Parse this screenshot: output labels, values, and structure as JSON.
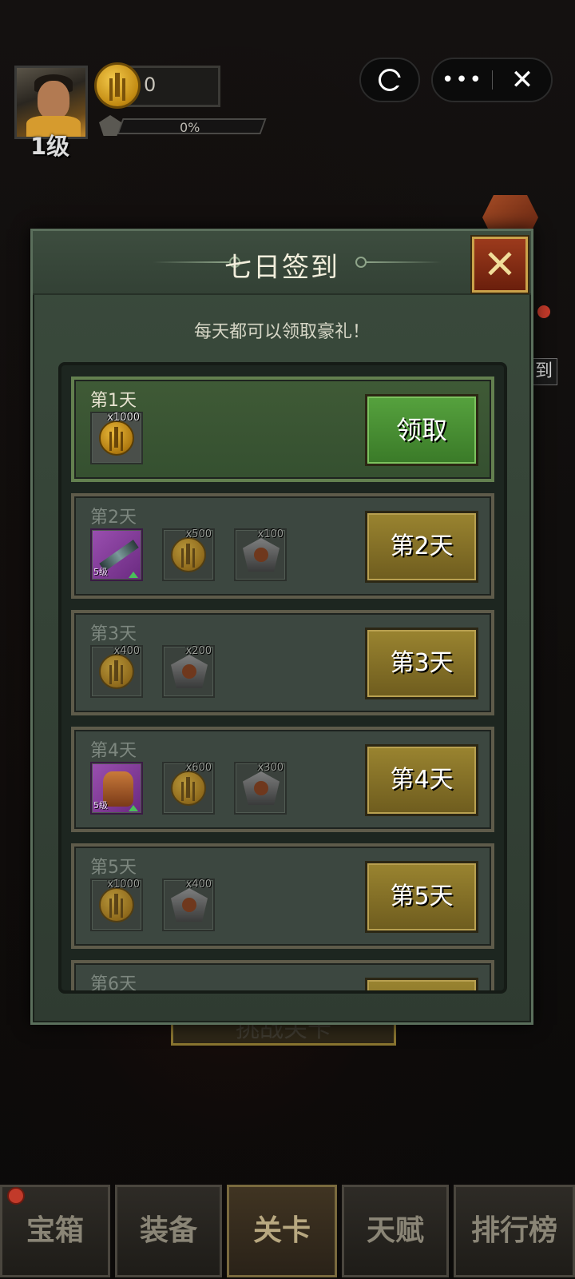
{
  "hud": {
    "level": "1级",
    "coins": "0",
    "xp_percent": "0%"
  },
  "capsule": {
    "more": "•••",
    "close": "✕"
  },
  "background": {
    "side_tag": "到",
    "bg_button": "挑战关卡"
  },
  "dialog": {
    "title": "七日签到",
    "subtitle": "每天都可以领取豪礼！",
    "close_symbol": "✕",
    "days": [
      {
        "label": "第1天",
        "button": "领取",
        "items": [
          {
            "type": "coin",
            "qty": "x1000"
          }
        ]
      },
      {
        "label": "第2天",
        "button": "第2天",
        "items": [
          {
            "type": "weapon",
            "level": "5级"
          },
          {
            "type": "coin",
            "qty": "x500"
          },
          {
            "type": "badge",
            "qty": "x100"
          }
        ]
      },
      {
        "label": "第3天",
        "button": "第3天",
        "items": [
          {
            "type": "coin",
            "qty": "x400"
          },
          {
            "type": "badge",
            "qty": "x200"
          }
        ]
      },
      {
        "label": "第4天",
        "button": "第4天",
        "items": [
          {
            "type": "armor",
            "level": "5级"
          },
          {
            "type": "coin",
            "qty": "x600"
          },
          {
            "type": "badge",
            "qty": "x300"
          }
        ]
      },
      {
        "label": "第5天",
        "button": "第5天",
        "items": [
          {
            "type": "coin",
            "qty": "x1000"
          },
          {
            "type": "badge",
            "qty": "x400"
          }
        ]
      },
      {
        "label": "第6天"
      }
    ]
  },
  "nav": {
    "tabs": [
      "宝箱",
      "装备",
      "关卡",
      "天赋",
      "排行榜"
    ]
  }
}
